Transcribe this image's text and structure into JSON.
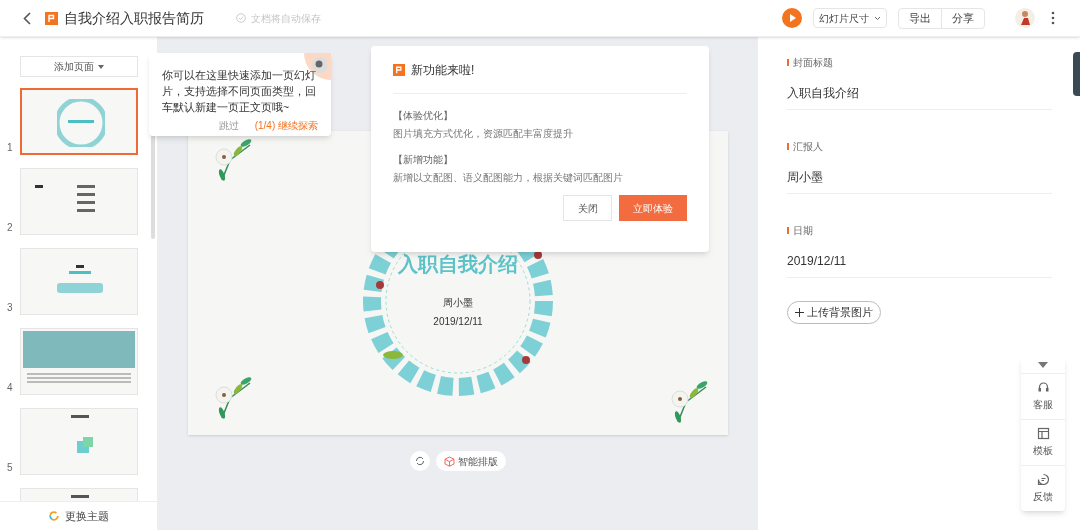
{
  "header": {
    "title": "自我介绍入职报告简历",
    "save_status": "文档将自动保存",
    "slide_size": "幻灯片尺寸",
    "buttons": [
      "导出",
      "分享"
    ]
  },
  "sidebar": {
    "add_page": "添加页面",
    "slides": [
      {
        "number": "1",
        "selected": true,
        "kind": "cover"
      },
      {
        "number": "2",
        "selected": false,
        "kind": "toc"
      },
      {
        "number": "3",
        "selected": false,
        "kind": "section"
      },
      {
        "number": "4",
        "selected": false,
        "kind": "photo"
      },
      {
        "number": "5",
        "selected": false,
        "kind": "content"
      },
      {
        "selected": false,
        "kind": "content"
      }
    ],
    "theme_button": "更换主题"
  },
  "tooltip": {
    "text": "你可以在这里快速添加一页幻灯片，支持选择不同页面类型，回车默认新建一页正文页哦~",
    "skip": "跳过",
    "next": "(1/4) 继续探索"
  },
  "dialog": {
    "title": "新功能来啦!",
    "sections": [
      {
        "heading": "【体验优化】",
        "body": "图片填充方式优化，资源匹配丰富度提升"
      },
      {
        "heading": "【新增功能】",
        "body": "新增以文配图、语义配图能力，根据关键词匹配图片"
      }
    ],
    "close": "关闭",
    "confirm": "立即体验"
  },
  "slide": {
    "title": "入职自我介绍",
    "presenter": "周小墨",
    "date": "2019/12/11"
  },
  "canvas_tools": {
    "smart_layout": "智能排版"
  },
  "properties": {
    "fields": [
      {
        "label": "封面标题",
        "value": "入职自我介绍"
      },
      {
        "label": "汇报人",
        "value": "周小墨"
      },
      {
        "label": "日期",
        "value": "2019/12/11"
      }
    ],
    "upload": "上传背景图片"
  },
  "float_toolbar": [
    "客服",
    "模板",
    "反馈"
  ]
}
